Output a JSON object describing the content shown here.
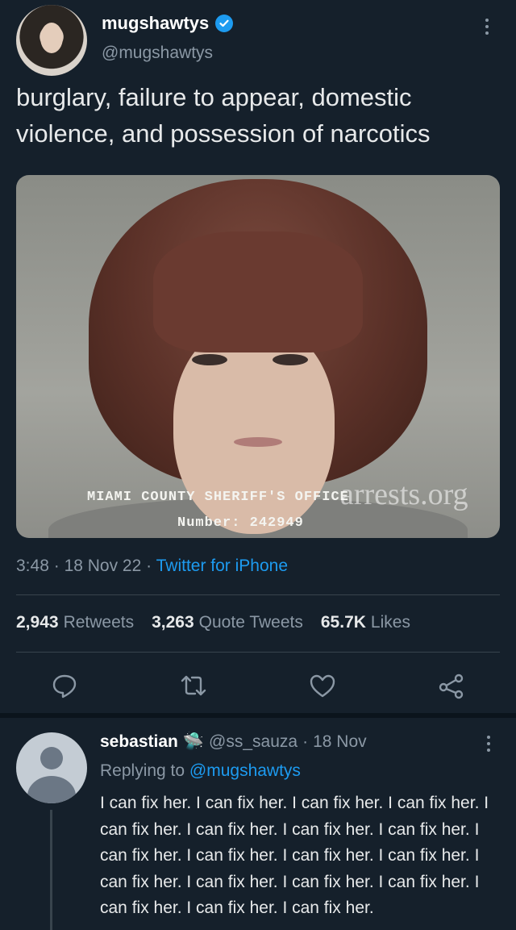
{
  "tweet": {
    "display_name": "mugshawtys",
    "handle": "@mugshawtys",
    "text": "burglary, failure to appear, domestic violence, and possession of narcotics",
    "photo": {
      "caption_line1": "MIAMI COUNTY SHERIFF'S OFFICE",
      "caption_line2": "Number: 242949",
      "watermark": "arrests.org"
    },
    "time": "3:48",
    "date": "18 Nov 22",
    "separator": "·",
    "source": "Twitter for iPhone",
    "stats": {
      "retweets_count": "2,943",
      "retweets_label": "Retweets",
      "quotes_count": "3,263",
      "quotes_label": "Quote Tweets",
      "likes_count": "65.7K",
      "likes_label": "Likes"
    }
  },
  "reply": {
    "display_name": "sebastian",
    "emoji": "🛸",
    "handle": "@ss_sauza",
    "date": "18 Nov",
    "replying_prefix": "Replying to",
    "replying_to": "@mugshawtys",
    "text": "I can fix her. I can fix her. I can fix her. I can fix her. I can fix her. I can fix her. I can fix her. I can fix her. I can fix her. I can fix her. I can fix her. I can fix her. I can fix her. I can fix her. I can fix her. I can fix her. I can fix her. I can fix her. I can fix her."
  },
  "colors": {
    "background": "#15202b",
    "accent": "#1d9bf0",
    "muted": "#8b98a5",
    "divider": "#38444d"
  },
  "icons": [
    "verified-badge-icon",
    "more-icon",
    "reply-icon",
    "retweet-icon",
    "like-icon",
    "share-icon"
  ]
}
